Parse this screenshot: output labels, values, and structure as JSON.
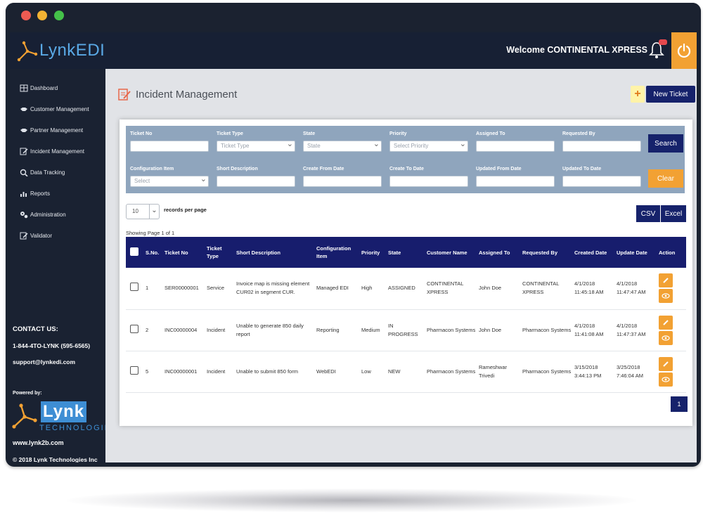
{
  "header": {
    "app_name": "LynkEDI",
    "welcome": "Welcome CONTINENTAL XPRESS",
    "notification_count": "10"
  },
  "sidebar": {
    "items": [
      {
        "label": "Dashboard",
        "icon": "dashboard-icon"
      },
      {
        "label": "Customer Management",
        "icon": "handshake-icon"
      },
      {
        "label": "Partner Management",
        "icon": "handshake-icon"
      },
      {
        "label": "Incident Management",
        "icon": "edit-document-icon"
      },
      {
        "label": "Data Tracking",
        "icon": "search-icon"
      },
      {
        "label": "Reports",
        "icon": "bar-chart-icon"
      },
      {
        "label": "Administration",
        "icon": "gears-icon"
      },
      {
        "label": "Validator",
        "icon": "edit-icon"
      }
    ],
    "contact_title": "CONTACT US:",
    "phone": "1-844-4TO-LYNK (595-6565)",
    "email": "support@lynkedi.com",
    "powered_by": "Powered by:",
    "company_word": "Lynk",
    "company_sub": "TECHNOLOGIES",
    "website": "www.lynk2b.com",
    "copyright": "© 2018 Lynk Technologies Inc"
  },
  "page": {
    "title": "Incident Management",
    "new_ticket": "New Ticket",
    "plus": "+"
  },
  "filters": {
    "ticket_no": {
      "label": "Ticket No",
      "value": ""
    },
    "ticket_type": {
      "label": "Ticket Type",
      "placeholder": "Ticket Type"
    },
    "state": {
      "label": "State",
      "placeholder": "State"
    },
    "priority": {
      "label": "Priority",
      "placeholder": "Select Priority"
    },
    "assigned_to": {
      "label": "Assigned To",
      "value": ""
    },
    "requested_by": {
      "label": "Requested By",
      "value": ""
    },
    "configuration_item": {
      "label": "Configuration Item",
      "placeholder": "Select"
    },
    "short_description": {
      "label": "Short Description",
      "value": ""
    },
    "create_from_date": {
      "label": "Create From Date",
      "value": ""
    },
    "create_to_date": {
      "label": "Create To Date",
      "value": ""
    },
    "updated_from_date": {
      "label": "Updated From Date",
      "value": ""
    },
    "updated_to_date": {
      "label": "Updated To Date",
      "value": ""
    },
    "search_label": "Search",
    "clear_label": "Clear"
  },
  "table_controls": {
    "records_per_page": "10",
    "records_label": "records per page",
    "csv": "CSV",
    "excel": "Excel",
    "showing": "Showing Page 1 of 1"
  },
  "table": {
    "columns": [
      "S.No.",
      "Ticket No",
      "Ticket Type",
      "Short Description",
      "Configuration Item",
      "Priority",
      "State",
      "Customer Name",
      "Assigned To",
      "Requested By",
      "Created Date",
      "Update Date",
      "Action"
    ],
    "rows": [
      {
        "sno": "1",
        "ticket_no": "SER00000001",
        "type": "Service",
        "desc": "Invoice map is missing element CUR02 in segment CUR.",
        "config": "Managed EDI",
        "priority": "High",
        "state": "ASSIGNED",
        "customer": "CONTINENTAL XPRESS",
        "assigned": "John Doe",
        "requested": "CONTINENTAL XPRESS",
        "created": "4/1/2018 11:45:18 AM",
        "updated": "4/1/2018 11:47:47 AM"
      },
      {
        "sno": "2",
        "ticket_no": "INC00000004",
        "type": "Incident",
        "desc": "Unable to generate 850 daily report",
        "config": "Reporting",
        "priority": "Medium",
        "state": "IN PROGRESS",
        "customer": "Pharmacon Systems",
        "assigned": "John Doe",
        "requested": "Pharmacon Systems",
        "created": "4/1/2018 11:41:08 AM",
        "updated": "4/1/2018 11:47:37 AM"
      },
      {
        "sno": "5",
        "ticket_no": "INC00000001",
        "type": "Incident",
        "desc": "Unable to submit 850 form",
        "config": "WebEDI",
        "priority": "Low",
        "state": "NEW",
        "customer": "Pharmacon Systems",
        "assigned": "Rameshwar Trivedi",
        "requested": "Pharmacon Systems",
        "created": "3/15/2018 3:44:13 PM",
        "updated": "3/25/2018 7:46:04 AM"
      }
    ]
  },
  "pagination": {
    "current": "1"
  },
  "colors": {
    "navy": "#16226b",
    "orange": "#f2a133",
    "sidebar": "#1a2232",
    "filter_bg": "#8fa5bd"
  }
}
